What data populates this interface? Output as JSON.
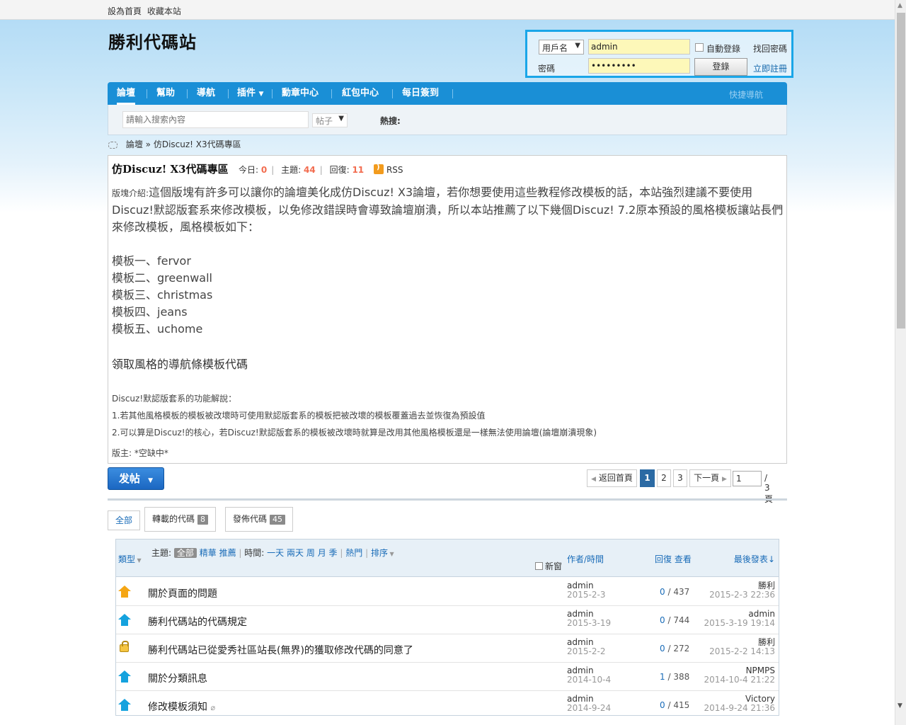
{
  "topbar": {
    "set_home": "設為首頁",
    "bookmark": "收藏本站"
  },
  "logo": "勝利代碼站",
  "login": {
    "select_value": "用戶名",
    "username_value": "admin",
    "password_value": "•••••••••",
    "password_label": "密碼",
    "auto_login": "自動登錄",
    "find_password": "找回密碼",
    "login_button": "登錄",
    "register": "立即註冊"
  },
  "nav": {
    "items": [
      "論壇",
      "幫助",
      "導航",
      "插件",
      "勳章中心",
      "紅包中心",
      "每日簽到"
    ],
    "quick_nav": "快捷導航"
  },
  "search": {
    "placeholder": "請輸入搜索內容",
    "type": "帖子",
    "hot": "熱搜:"
  },
  "breadcrumb": {
    "forum": "論壇",
    "sep": "»",
    "current": "仿Discuz! X3代碼專區"
  },
  "forum": {
    "title": "仿Discuz! X3代碼專區",
    "today_label": "今日:",
    "today": "0",
    "threads_label": "主題:",
    "threads": "44",
    "replies_label": "回復:",
    "replies": "11",
    "rss": "RSS",
    "intro_tag": "版塊介紹:",
    "intro": "這個版塊有許多可以讓你的論壇美化成仿Discuz! X3論壇，若你想要使用這些教程修改模板的話，本站強烈建議不要使用Discuz!默認版套系來修改模板，以免修改錯誤時會導致論壇崩潰，所以本站推薦了以下幾個Discuz! 7.2原本預設的風格模板讓站長們來修改模板，風格模板如下：",
    "templates": [
      "模板一、fervor",
      "模板二、greenwall",
      "模板三、christmas",
      "模板四、jeans",
      "模板五、uchome"
    ],
    "nav_heading": "領取風格的導航條模板代碼",
    "notes_title": "Discuz!默認版套系的功能解說：",
    "note1": "1.若其他風格模板的模板被改壞時可使用默認版套系的模板把被改壞的模板覆蓋過去並恢復為預設值",
    "note2": "2.可以算是Discuz!的核心，若Discuz!默認版套系的模板被改壞時就算是改用其他風格模板還是一樣無法使用論壇(論壇崩潰現象)",
    "moderator": "版主: *空缺中*"
  },
  "post_button": "发帖",
  "pager": {
    "back": "返回首頁",
    "pages": [
      "1",
      "2",
      "3"
    ],
    "next": "下一頁",
    "jump_value": "1",
    "total": "/ 3 頁"
  },
  "tabs": {
    "all": "全部",
    "repost": "轉載的代碼",
    "repost_count": "8",
    "publish": "發佈代碼",
    "publish_count": "45"
  },
  "thead": {
    "type": "類型",
    "theme_label": "主題:",
    "theme_all": "全部",
    "digest": "精華",
    "recommend": "推薦",
    "time_label": "時間:",
    "t1": "一天",
    "t2": "兩天",
    "t3": "周",
    "t4": "月",
    "t5": "季",
    "hot": "熱門",
    "sort": "排序",
    "new_window": "新窗",
    "author_time": "作者/時間",
    "reply_view": "回復 查看",
    "last_post": "最後發表"
  },
  "threads": [
    {
      "icon": "pin-orange-icon",
      "subject": "關於頁面的問題",
      "author": "admin",
      "date": "2015-2-3",
      "replies": "0",
      "views": "437",
      "last_user": "勝利",
      "last_time": "2015-2-3 22:36"
    },
    {
      "icon": "pin-blue-icon",
      "subject": "勝利代碼站的代碼規定",
      "author": "admin",
      "date": "2015-3-19",
      "replies": "0",
      "views": "744",
      "last_user": "admin",
      "last_time": "2015-3-19 19:14"
    },
    {
      "icon": "lock-icon",
      "subject": "勝利代碼站已從愛秀社區站長(無界)的獲取修改代碼的同意了",
      "author": "admin",
      "date": "2015-2-2",
      "replies": "0",
      "views": "272",
      "last_user": "勝利",
      "last_time": "2015-2-2 14:13"
    },
    {
      "icon": "pin-blue-icon",
      "subject": "關於分類訊息",
      "author": "admin",
      "date": "2014-10-4",
      "replies": "1",
      "views": "388",
      "last_user": "NPMPS",
      "last_time": "2014-10-4 21:22"
    },
    {
      "icon": "pin-blue-icon",
      "subject": "修改模板須知",
      "author": "admin",
      "date": "2014-9-24",
      "replies": "0",
      "views": "415",
      "last_user": "Victory",
      "last_time": "2014-9-24 21:36"
    }
  ]
}
